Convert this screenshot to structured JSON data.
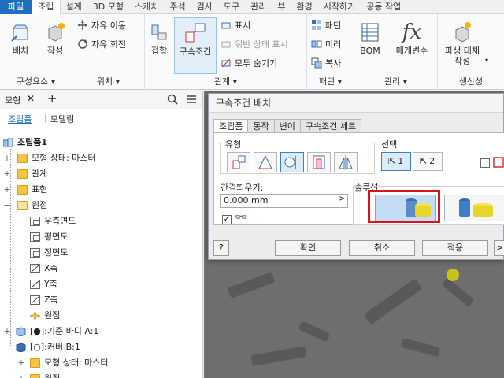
{
  "tabs": [
    "파일",
    "조립",
    "설계",
    "3D 모형",
    "스케치",
    "주석",
    "검사",
    "도구",
    "관리",
    "뷰",
    "환경",
    "시작하기",
    "공동 작업"
  ],
  "ribbon": {
    "component": {
      "place": "배치",
      "create": "작성",
      "title": "구성요소 ▾"
    },
    "position": {
      "free_move": "자유 이동",
      "free_rotate": "자유 회전",
      "title": "위치 ▾"
    },
    "relationships": {
      "joint": "접합",
      "constraint": "구속조건",
      "show": "표시",
      "show_sick": "위반 상태 표시",
      "hide_all": "모두 숨기기",
      "title": "관계 ▾"
    },
    "pattern": {
      "pattern": "패턴",
      "mirror": "미러",
      "copy": "복사",
      "title": "패턴 ▾"
    },
    "manage": {
      "bom": "BOM",
      "params": "매개변수",
      "title": "관리 ▾"
    },
    "productivity": {
      "derived": "파생 대체",
      "create": "작성",
      "title": "생산성"
    }
  },
  "browser": {
    "tab_label": "모형",
    "close": "✕",
    "add": "+",
    "subtabs": [
      "조립품",
      "모델링"
    ],
    "tree": [
      {
        "label": "조립품1",
        "bold": true
      },
      {
        "label": "모형 상태: 마스터"
      },
      {
        "label": "관계"
      },
      {
        "label": "표현"
      },
      {
        "label": "원점"
      },
      {
        "label": "우측면도"
      },
      {
        "label": "평면도"
      },
      {
        "label": "정면도"
      },
      {
        "label": "X축"
      },
      {
        "label": "Y축"
      },
      {
        "label": "Z축"
      },
      {
        "label": "원점"
      },
      {
        "label": "[●]:기준 바디 A:1"
      },
      {
        "label": "[○]:커버 B:1"
      },
      {
        "label": "모형 상태: 마스터"
      },
      {
        "label": "원점"
      }
    ]
  },
  "dialog": {
    "title": "구속조건 배치",
    "tabs": [
      "조립품",
      "동작",
      "변이",
      "구속조건 세트"
    ],
    "type_label": "유형",
    "selection_label": "선택",
    "select1": "1",
    "select2": "2",
    "offset_label": "간격띄우기:",
    "offset_value": "0.000 mm",
    "solution_label": "솔루션",
    "ok": "확인",
    "cancel": "취소",
    "apply": "적용",
    "help": "?",
    "more": ">"
  },
  "colors": {
    "accent": "#1f6fbf",
    "highlight": "#d8141a",
    "folder": "#f6c344"
  }
}
